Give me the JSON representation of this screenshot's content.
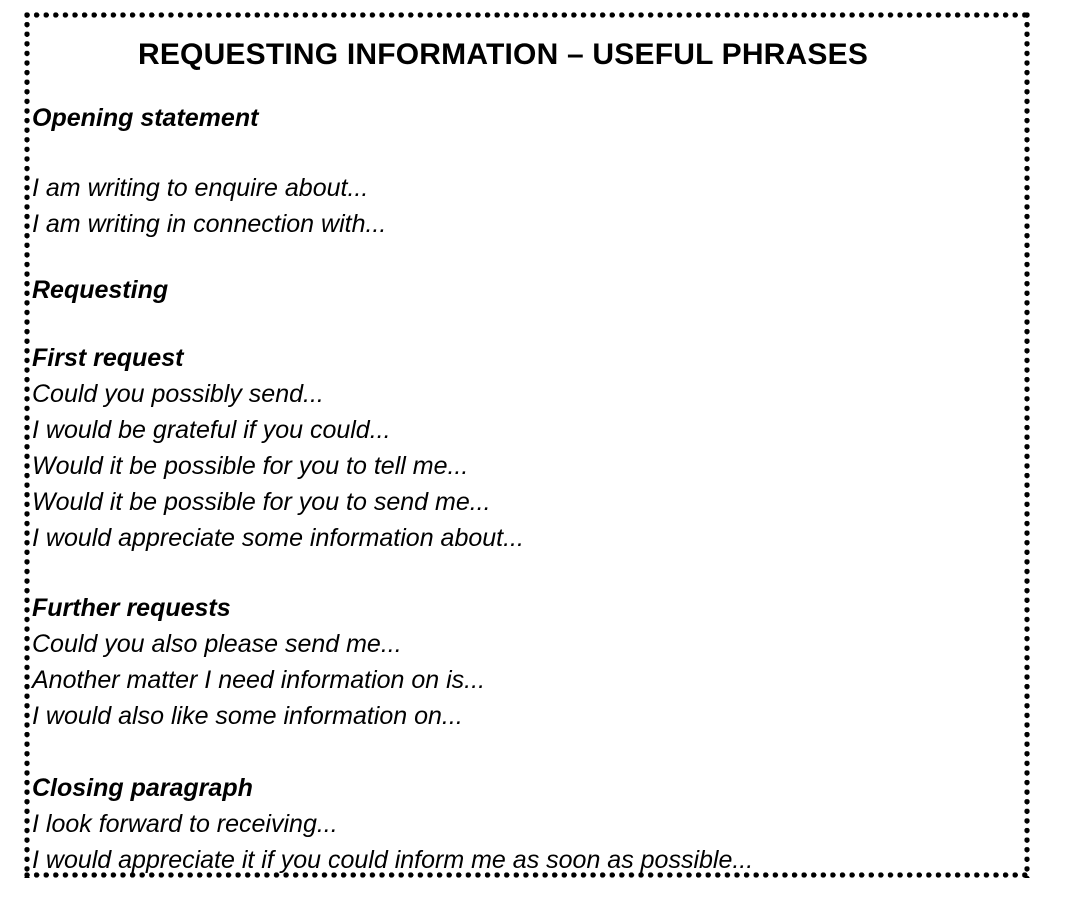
{
  "document": {
    "title": "REQUESTING INFORMATION – USEFUL PHRASES",
    "border_style": "dotted",
    "border_color": "#000000",
    "background_color": "#ffffff",
    "text_color": "#000000"
  },
  "sections": [
    {
      "heading": "Opening statement",
      "phrases": [
        "I am writing to enquire about...",
        "I am writing in connection with..."
      ]
    },
    {
      "heading": "Requesting",
      "phrases": []
    },
    {
      "heading": "First request",
      "phrases": [
        "Could you possibly send...",
        "I would be grateful if you could...",
        "Would it be possible for you to tell me...",
        "Would it be possible for you to send me...",
        "I would appreciate some information about..."
      ]
    },
    {
      "heading": "Further requests",
      "phrases": [
        "Could you also please send me...",
        "Another matter I need information on is...",
        "I would also like some information on..."
      ]
    },
    {
      "heading": "Closing paragraph",
      "phrases": [
        "I look forward to receiving...",
        "I would appreciate it if you could inform me as soon as possible..."
      ]
    }
  ]
}
